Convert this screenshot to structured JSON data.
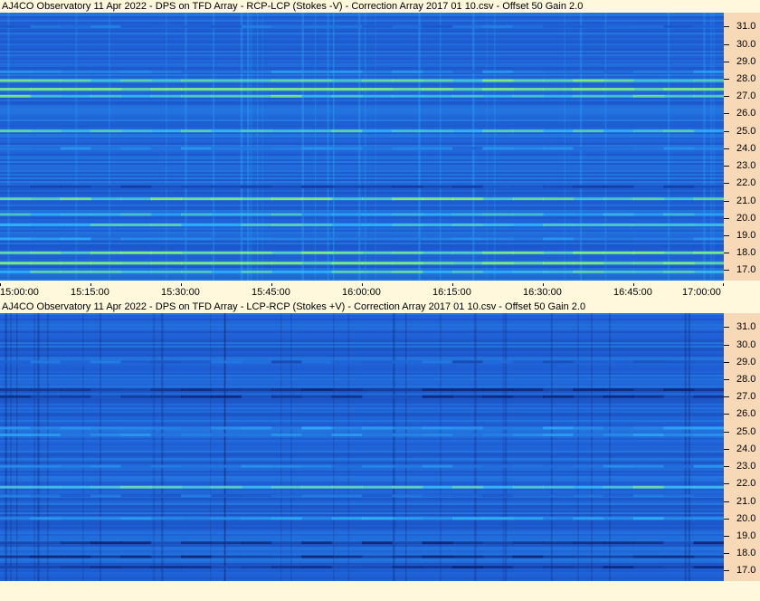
{
  "chart_data": [
    {
      "type": "heatmap",
      "title": "AJ4CO Observatory 11 Apr 2022  -  DPS on TFD Array  -  RCP-LCP (Stokes -V)  -  Correction Array 2017 01 10.csv  -  Offset 50  Gain 2.0",
      "x_ticks": [
        "15:00:00",
        "15:15:00",
        "15:30:00",
        "15:45:00",
        "16:00:00",
        "16:15:00",
        "16:30:00",
        "16:45:00",
        "17:00:00"
      ],
      "y_ticks": [
        "31.0",
        "30.0",
        "29.0",
        "28.0",
        "27.0",
        "26.0",
        "25.0",
        "24.0",
        "23.0",
        "22.0",
        "21.0",
        "20.0",
        "19.0",
        "18.0",
        "17.0"
      ],
      "ylim": [
        16.4,
        31.8
      ],
      "colors": {
        "base": "#1f5fd6",
        "dark": "#10309a",
        "bright": "#2fb8ff",
        "hot": "#8bff74"
      },
      "bands": [
        {
          "f": 31.0,
          "level": 0.35
        },
        {
          "f": 28.4,
          "level": 0.5
        },
        {
          "f": 27.9,
          "level": 0.9
        },
        {
          "f": 27.4,
          "level": 1.0
        },
        {
          "f": 27.0,
          "level": 0.85
        },
        {
          "f": 25.0,
          "level": 0.8
        },
        {
          "f": 24.0,
          "level": 0.45
        },
        {
          "f": 21.8,
          "level": 0.1
        },
        {
          "f": 21.1,
          "level": 0.9
        },
        {
          "f": 20.2,
          "level": 0.7
        },
        {
          "f": 19.6,
          "level": 0.75
        },
        {
          "f": 18.8,
          "level": 0.55
        },
        {
          "f": 18.0,
          "level": 0.95
        },
        {
          "f": 17.4,
          "level": 1.0
        },
        {
          "f": 16.9,
          "level": 0.8
        }
      ]
    },
    {
      "type": "heatmap",
      "title": "AJ4CO Observatory 11 Apr 2022  -  DPS on TFD Array  -  LCP-RCP (Stokes +V)  -  Correction Array 2017 01 10.csv  -  Offset 50  Gain 2.0",
      "x_ticks": [],
      "y_ticks": [
        "31.0",
        "30.0",
        "29.0",
        "28.0",
        "27.0",
        "26.0",
        "25.0",
        "24.0",
        "23.0",
        "22.0",
        "21.0",
        "20.0",
        "19.0",
        "18.0",
        "17.0"
      ],
      "ylim": [
        16.4,
        31.8
      ],
      "colors": {
        "base": "#1f5fd6",
        "dark": "#0a1e6e",
        "bright": "#2fb8ff",
        "hot": "#7cf0a0"
      },
      "bands": [
        {
          "f": 29.0,
          "level": 0.3
        },
        {
          "f": 27.4,
          "level": 0.05
        },
        {
          "f": 27.0,
          "level": 0.1
        },
        {
          "f": 25.2,
          "level": 0.55
        },
        {
          "f": 24.8,
          "level": 0.5
        },
        {
          "f": 23.0,
          "level": 0.45
        },
        {
          "f": 21.8,
          "level": 0.85
        },
        {
          "f": 21.3,
          "level": 0.35
        },
        {
          "f": 20.0,
          "level": 0.6
        },
        {
          "f": 18.6,
          "level": 0.1
        },
        {
          "f": 17.8,
          "level": 0.05
        },
        {
          "f": 17.2,
          "level": 0.08
        }
      ]
    }
  ]
}
